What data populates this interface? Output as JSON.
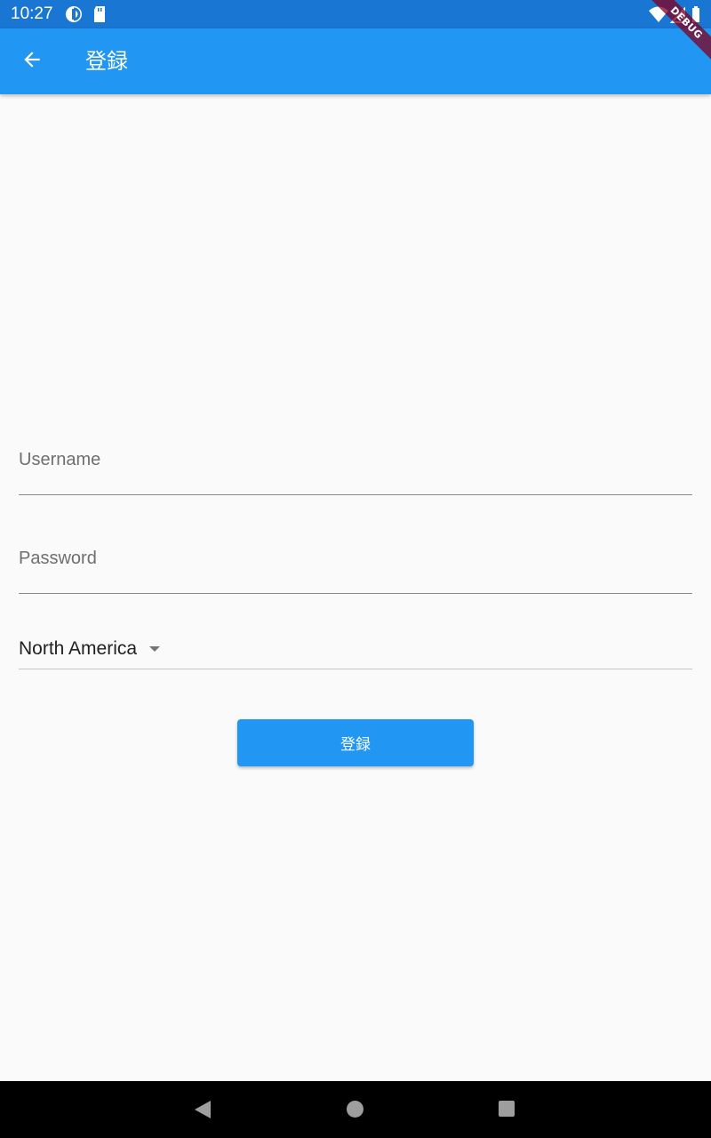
{
  "status_bar": {
    "time": "10:27",
    "left_icons": [
      "sync-icon",
      "sd-card-icon"
    ],
    "right_icons": [
      "wifi-icon",
      "cell-signal-icon",
      "battery-icon"
    ]
  },
  "app_bar": {
    "title": "登録",
    "back_icon": "arrow-back-icon",
    "color": "#2196f3"
  },
  "debug_banner": {
    "label": "DEBUG"
  },
  "form": {
    "username": {
      "placeholder": "Username",
      "value": ""
    },
    "password": {
      "placeholder": "Password",
      "value": ""
    },
    "region": {
      "selected": "North America"
    },
    "submit_label": "登録"
  },
  "nav_bar": {
    "icons": [
      "nav-back-icon",
      "nav-home-icon",
      "nav-recents-icon"
    ]
  },
  "colors": {
    "status_bar": "#1976d2",
    "accent": "#2196f3",
    "background": "#fafafa"
  }
}
